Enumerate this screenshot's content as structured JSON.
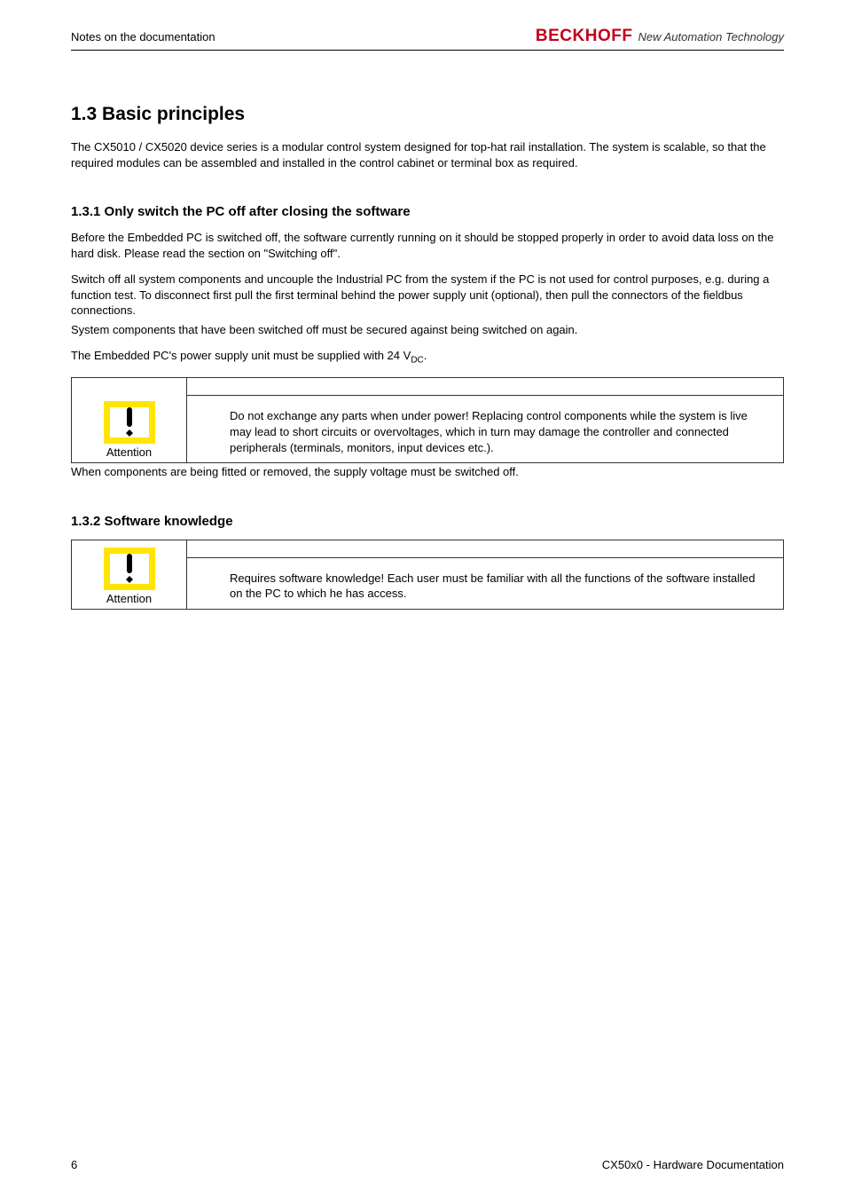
{
  "header": {
    "section": "Notes on the documentation",
    "brand": "BECKHOFF",
    "tagline": "New Automation Technology"
  },
  "sections": {
    "h_basic": "1.3 Basic principles",
    "p_basic": "The CX5010 / CX5020 device series is a modular control system designed for top-hat rail installation. The system is scalable, so that the required modules can be assembled and installed in the control cabinet or terminal box as required.",
    "h_safety": "1.3.1 Only switch the PC off after closing the software",
    "p_safety_1": "Before the Embedded PC is switched off, the software currently running on it should be stopped properly in order to avoid data loss on the hard disk. Please read the section on \"Switching off\".",
    "p_safety_2a": "Switch off all system components and uncouple the Industrial PC from the system if the PC is not used for control purposes, e.g. during a function test. To disconnect first pull the first terminal behind the power supply unit (optional), then pull the connectors of the fieldbus connections.",
    "p_safety_2b": "System components that have been switched off must be secured against being switched on again.",
    "p_safety_3_pre": "The Embedded PC's power supply unit must be supplied with 24 V",
    "p_safety_3_sub": "DC",
    "p_safety_3_post": ".",
    "p_after_notice1": "When components are being fitted or removed, the supply voltage must be switched off.",
    "h_software": "1.3.2 Software knowledge"
  },
  "notices": {
    "attention_label": "Attention",
    "n1_body": "Do not exchange any parts when under power! Replacing control components while the system is live may lead to short circuits or overvoltages, which in turn may damage the controller and connected peripherals (terminals, monitors, input devices etc.).",
    "n2_body": "Requires software knowledge!  Each user must be familiar with all the functions of the software installed on the PC to which he has access."
  },
  "footer": {
    "page": "6",
    "doc": "CX50x0 - Hardware Documentation"
  }
}
